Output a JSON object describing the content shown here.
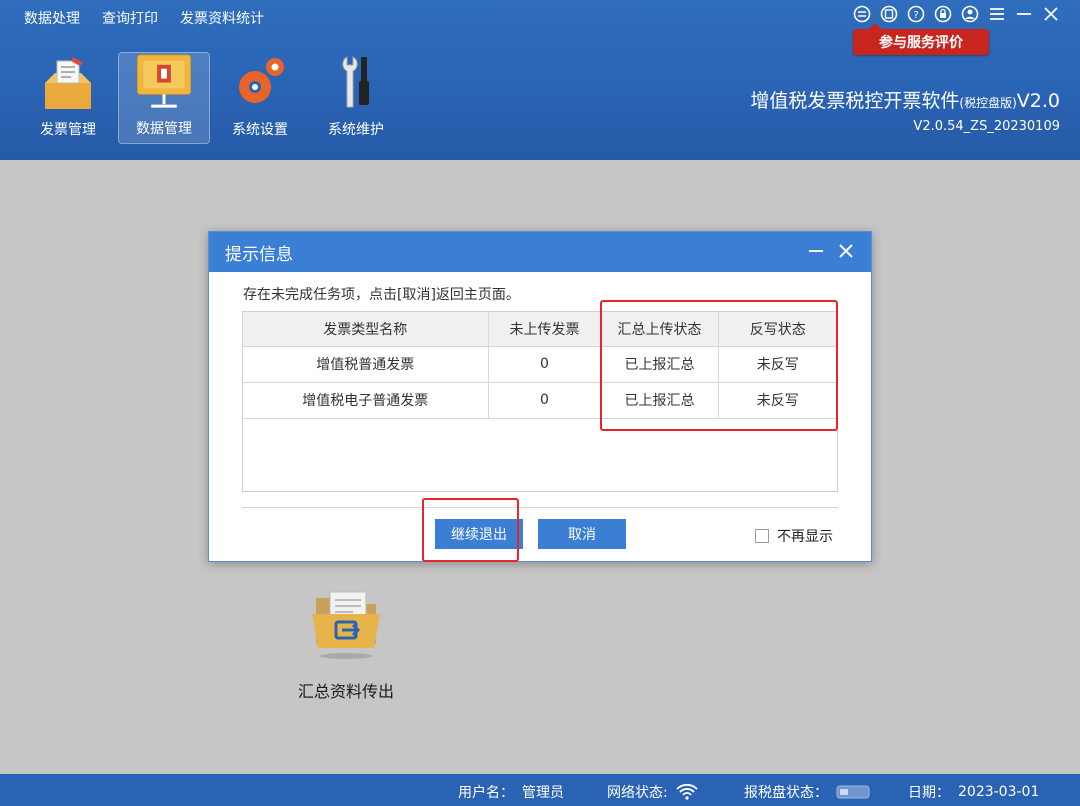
{
  "menu": [
    "数据处理",
    "查询打印",
    "发票资料统计"
  ],
  "service_badge": "参与服务评价",
  "toolbar": [
    {
      "label": "发票管理",
      "icon": "invoice-box-icon"
    },
    {
      "label": "数据管理",
      "icon": "data-folder-icon"
    },
    {
      "label": "系统设置",
      "icon": "gears-icon"
    },
    {
      "label": "系统维护",
      "icon": "wrench-screwdriver-icon"
    }
  ],
  "brand": {
    "title": "增值税发票税控开票软件",
    "edition": "(税控盘版)",
    "version_short": "V2.0",
    "version": "V2.0.54_ZS_20230109"
  },
  "desk_item": {
    "label": "汇总资料传出",
    "icon": "export-folder-icon"
  },
  "dialog": {
    "title": "提示信息",
    "message": "存在未完成任务项，点击[取消]返回主页面。",
    "columns": [
      "发票类型名称",
      "未上传发票",
      "汇总上传状态",
      "反写状态"
    ],
    "rows": [
      [
        "增值税普通发票",
        "0",
        "已上报汇总",
        "未反写"
      ],
      [
        "增值税电子普通发票",
        "0",
        "已上报汇总",
        "未反写"
      ]
    ],
    "btn_exit": "继续退出",
    "btn_cancel": "取消",
    "noshow_label": "不再显示"
  },
  "status": {
    "user_label": "用户名：",
    "user": "管理员",
    "network_label": "网络状态:",
    "disk_label": "报税盘状态：",
    "date_label": "日期：",
    "date": "2023-03-01"
  },
  "colors": {
    "header_blue": "#2a63b3",
    "dialog_blue": "#3a7fd4",
    "badge_red": "#c8251f",
    "highlight_red": "#e8262a"
  }
}
